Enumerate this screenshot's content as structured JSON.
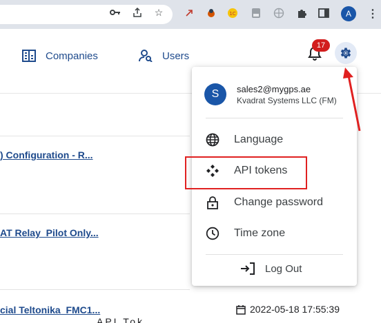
{
  "browser": {
    "icons": [
      "key-icon",
      "share-icon",
      "star-icon",
      "extension-icons",
      "puzzle-icon",
      "side-panel-icon"
    ],
    "profile_initial": "A",
    "menu_glyph": "⋮"
  },
  "header": {
    "nav": [
      {
        "label": "Companies",
        "icon": "companies-icon"
      },
      {
        "label": "Users",
        "icon": "users-icon"
      }
    ],
    "notification_count": "17"
  },
  "list": {
    "rows": [
      {
        "title": ") Configuration - R..."
      },
      {
        "title": "AT Relay_Pilot Only..."
      },
      {
        "title": "cial Teltonika_FMC1..."
      }
    ],
    "last_row_date": "2022-05-18 17:55:39",
    "bottom_partial_text": "API Tok"
  },
  "menu": {
    "user": {
      "initial": "S",
      "email": "sales2@mygps.ae",
      "company": "Kvadrat Systems LLC (FM)"
    },
    "items": [
      {
        "label": "Language",
        "icon": "globe-icon"
      },
      {
        "label": "API tokens",
        "icon": "api-icon"
      },
      {
        "label": "Change password",
        "icon": "lock-icon"
      },
      {
        "label": "Time zone",
        "icon": "clock-icon"
      }
    ],
    "logout_label": "Log Out"
  },
  "colors": {
    "accent": "#1e4a8c",
    "avatar": "#1a56a8",
    "badge": "#d21d1d",
    "annotation": "#e02020"
  }
}
